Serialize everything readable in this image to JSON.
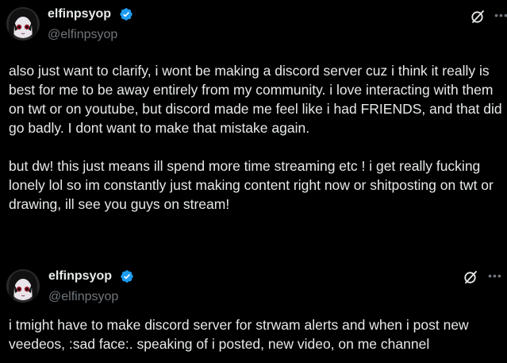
{
  "tweets": [
    {
      "display_name": "elfinpsyop",
      "handle": "@elfinpsyop",
      "verified": true,
      "text": "also just want to clarify, i wont be making a discord server cuz i think it really is best for me to be away entirely from my community. i love interacting with them on twt or on youtube, but discord made me feel like i had FRIENDS, and that did go badly. I dont want to make that mistake again.\n\nbut dw! this just means ill spend more time streaming etc ! i get really fucking lonely lol so im constantly just making content right now or shitposting on twt or drawing, ill see you guys on stream!"
    },
    {
      "display_name": "elfinpsyop",
      "handle": "@elfinpsyop",
      "verified": true,
      "text": "i tmight have to make discord server for strwam alerts and when i post new veedeos, :sad face:. speaking of i posted, new video, on me channel"
    }
  ],
  "icons": {
    "avatar": "avatar-image",
    "verified": "verified-badge-icon",
    "grok": "grok-icon",
    "more": "more-options-icon"
  },
  "colors": {
    "background": "#000000",
    "text_primary": "#e7e9ea",
    "text_secondary": "#71767b",
    "verified_blue": "#1d9bf0"
  }
}
